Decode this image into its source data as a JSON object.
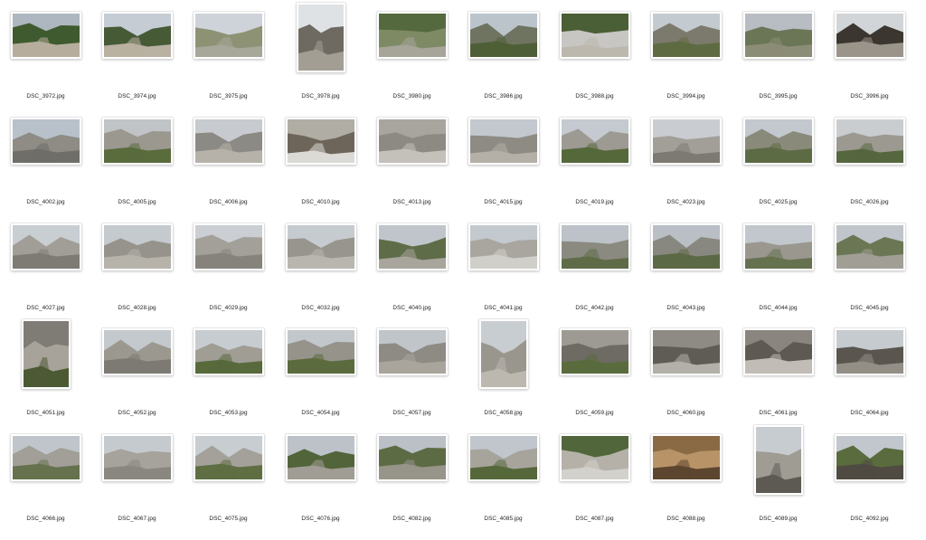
{
  "window": {
    "view": "icon-grid"
  },
  "files": [
    {
      "name": "DSC_3972.jpg",
      "orientation": "landscape",
      "palette": [
        "#aeb7c0",
        "#3f5a2e",
        "#b6ad9c"
      ]
    },
    {
      "name": "DSC_3974.jpg",
      "orientation": "landscape",
      "palette": [
        "#c5ccd3",
        "#465a36",
        "#b9b1a1"
      ]
    },
    {
      "name": "DSC_3975.jpg",
      "orientation": "landscape",
      "palette": [
        "#cdd3d8",
        "#8e9275",
        "#a7a79a"
      ]
    },
    {
      "name": "DSC_3978.jpg",
      "orientation": "portrait",
      "palette": [
        "#dfe2e5",
        "#6f6a61",
        "#a39e94"
      ]
    },
    {
      "name": "DSC_3980.jpg",
      "orientation": "landscape",
      "palette": [
        "#55693f",
        "#7e8a64",
        "#a7a49a"
      ]
    },
    {
      "name": "DSC_3986.jpg",
      "orientation": "landscape",
      "palette": [
        "#bcc4cb",
        "#6f7460",
        "#4e5f37"
      ]
    },
    {
      "name": "DSC_3988.jpg",
      "orientation": "landscape",
      "palette": [
        "#4a5f35",
        "#c7c6c2",
        "#bcb8ae"
      ]
    },
    {
      "name": "DSC_3994.jpg",
      "orientation": "landscape",
      "palette": [
        "#c3cad0",
        "#7c7a6c",
        "#5e6b42"
      ]
    },
    {
      "name": "DSC_3995.jpg",
      "orientation": "landscape",
      "palette": [
        "#b7bdc3",
        "#6a7656",
        "#8c8d76"
      ]
    },
    {
      "name": "DSC_3996.jpg",
      "orientation": "landscape",
      "palette": [
        "#d2d5d8",
        "#3b362f",
        "#9a948a"
      ]
    },
    {
      "name": "DSC_4002.jpg",
      "orientation": "landscape",
      "palette": [
        "#b8c1ca",
        "#8e8c85",
        "#6f6e68"
      ]
    },
    {
      "name": "DSC_4005.jpg",
      "orientation": "landscape",
      "palette": [
        "#c0c4c6",
        "#9b9890",
        "#5a6b3c"
      ]
    },
    {
      "name": "DSC_4006.jpg",
      "orientation": "landscape",
      "palette": [
        "#c7cbcf",
        "#8c8a84",
        "#b6b2aa"
      ]
    },
    {
      "name": "DSC_4010.jpg",
      "orientation": "landscape",
      "palette": [
        "#b0ada4",
        "#6e655a",
        "#dcdad6"
      ]
    },
    {
      "name": "DSC_4013.jpg",
      "orientation": "landscape",
      "palette": [
        "#a8a59f",
        "#8d8a84",
        "#c4c1bb"
      ]
    },
    {
      "name": "DSC_4015.jpg",
      "orientation": "landscape",
      "palette": [
        "#c2c8cd",
        "#8d8b84",
        "#b4b0a8"
      ]
    },
    {
      "name": "DSC_4019.jpg",
      "orientation": "landscape",
      "palette": [
        "#c4cacf",
        "#9d9a93",
        "#55683a"
      ]
    },
    {
      "name": "DSC_4023.jpg",
      "orientation": "landscape",
      "palette": [
        "#c9cdd1",
        "#a29f98",
        "#7c7a72"
      ]
    },
    {
      "name": "DSC_4025.jpg",
      "orientation": "landscape",
      "palette": [
        "#c2c8ce",
        "#8a8a7a",
        "#5d6b45"
      ]
    },
    {
      "name": "DSC_4026.jpg",
      "orientation": "landscape",
      "palette": [
        "#c9cdd0",
        "#9c9991",
        "#56663e"
      ]
    },
    {
      "name": "DSC_4027.jpg",
      "orientation": "landscape",
      "palette": [
        "#c9ced3",
        "#a19e97",
        "#7d7b74"
      ]
    },
    {
      "name": "DSC_4028.jpg",
      "orientation": "landscape",
      "palette": [
        "#c5cacf",
        "#96938c",
        "#b7b3ab"
      ]
    },
    {
      "name": "DSC_4029.jpg",
      "orientation": "landscape",
      "palette": [
        "#cbcfd3",
        "#a3a09a",
        "#85837c"
      ]
    },
    {
      "name": "DSC_4032.jpg",
      "orientation": "landscape",
      "palette": [
        "#c6cbd0",
        "#98958e",
        "#b9b6af"
      ]
    },
    {
      "name": "DSC_4040.jpg",
      "orientation": "landscape",
      "palette": [
        "#bfc5cb",
        "#5f6c48",
        "#a8a59d"
      ]
    },
    {
      "name": "DSC_4041.jpg",
      "orientation": "landscape",
      "palette": [
        "#c3c9ce",
        "#a9a69f",
        "#d1cfca"
      ]
    },
    {
      "name": "DSC_4042.jpg",
      "orientation": "landscape",
      "palette": [
        "#bcc2c8",
        "#8b8a80",
        "#5f6b47"
      ]
    },
    {
      "name": "DSC_4043.jpg",
      "orientation": "landscape",
      "palette": [
        "#b9bfc5",
        "#898880",
        "#5c6946"
      ]
    },
    {
      "name": "DSC_4044.jpg",
      "orientation": "landscape",
      "palette": [
        "#c1c7cc",
        "#9a978f",
        "#66714f"
      ]
    },
    {
      "name": "DSC_4045.jpg",
      "orientation": "landscape",
      "palette": [
        "#bfc5cb",
        "#6b7754",
        "#a19e96"
      ]
    },
    {
      "name": "DSC_4051.jpg",
      "orientation": "portrait",
      "palette": [
        "#7f7c76",
        "#a7a39b",
        "#4c5a34"
      ]
    },
    {
      "name": "DSC_4052.jpg",
      "orientation": "landscape",
      "palette": [
        "#c4c9ce",
        "#9b988f",
        "#7c7a73"
      ]
    },
    {
      "name": "DSC_4053.jpg",
      "orientation": "landscape",
      "palette": [
        "#c7ccd1",
        "#a09d95",
        "#58693c"
      ]
    },
    {
      "name": "DSC_4054.jpg",
      "orientation": "landscape",
      "palette": [
        "#c2c7cc",
        "#96938b",
        "#5b6b3e"
      ]
    },
    {
      "name": "DSC_4057.jpg",
      "orientation": "landscape",
      "palette": [
        "#c0c5ca",
        "#8e8b84",
        "#a9a59d"
      ]
    },
    {
      "name": "DSC_4058.jpg",
      "orientation": "portrait",
      "palette": [
        "#c8cdd2",
        "#99968e",
        "#bcb8b0"
      ]
    },
    {
      "name": "DSC_4059.jpg",
      "orientation": "landscape",
      "palette": [
        "#9d9a93",
        "#6e6b64",
        "#5a6b3d"
      ]
    },
    {
      "name": "DSC_4060.jpg",
      "orientation": "landscape",
      "palette": [
        "#8e8b84",
        "#5f5c56",
        "#b3b0a9"
      ]
    },
    {
      "name": "DSC_4061.jpg",
      "orientation": "landscape",
      "palette": [
        "#8a867f",
        "#5e5a53",
        "#c1bdb6"
      ]
    },
    {
      "name": "DSC_4064.jpg",
      "orientation": "landscape",
      "palette": [
        "#c6cbd0",
        "#5a564f",
        "#938f87"
      ]
    },
    {
      "name": "DSC_4066.jpg",
      "orientation": "landscape",
      "palette": [
        "#bfc5cb",
        "#a29f98",
        "#66714e"
      ]
    },
    {
      "name": "DSC_4067.jpg",
      "orientation": "landscape",
      "palette": [
        "#c5cacf",
        "#a6a39c",
        "#8a8780"
      ]
    },
    {
      "name": "DSC_4075.jpg",
      "orientation": "landscape",
      "palette": [
        "#c8cdd2",
        "#a4a19a",
        "#5f6e43"
      ]
    },
    {
      "name": "DSC_4076.jpg",
      "orientation": "landscape",
      "palette": [
        "#bcc2c8",
        "#52643a",
        "#a09d95"
      ]
    },
    {
      "name": "DSC_4082.jpg",
      "orientation": "landscape",
      "palette": [
        "#bac0c6",
        "#5d6b45",
        "#979489"
      ]
    },
    {
      "name": "DSC_4085.jpg",
      "orientation": "landscape",
      "palette": [
        "#c0c6cc",
        "#a7a49c",
        "#56683b"
      ]
    },
    {
      "name": "DSC_4087.jpg",
      "orientation": "landscape",
      "palette": [
        "#51663a",
        "#b5b1a9",
        "#d3d1cc"
      ]
    },
    {
      "name": "DSC_4088.jpg",
      "orientation": "landscape",
      "palette": [
        "#8a6a45",
        "#b99368",
        "#5c4630"
      ]
    },
    {
      "name": "DSC_4089.jpg",
      "orientation": "portrait",
      "palette": [
        "#c7ccd1",
        "#9f9c94",
        "#5d5a53"
      ]
    },
    {
      "name": "DSC_4092.jpg",
      "orientation": "landscape",
      "palette": [
        "#c1c7cd",
        "#5a6b3e",
        "#4f4a42"
      ]
    }
  ]
}
